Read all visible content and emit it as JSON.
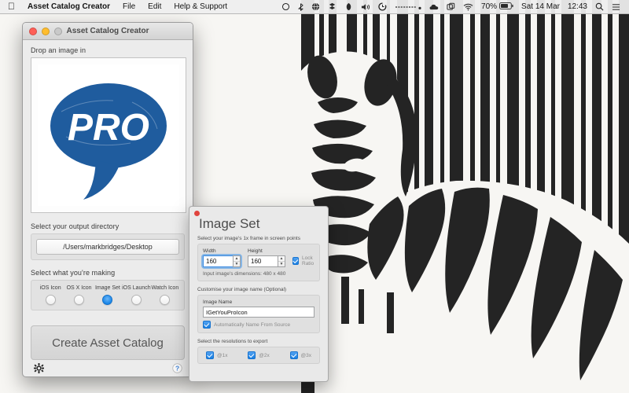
{
  "menubar": {
    "apple_icon": "apple-logo-icon",
    "app_name": "Asset Catalog Creator",
    "menus": [
      "File",
      "Edit",
      "Help & Support"
    ],
    "status_icons": [
      "airplay-icon",
      "bluetooth-icon",
      "globe-icon",
      "dropbox-icon",
      "cleanmymac-icon",
      "volume-icon",
      "timemachine-icon",
      "divider-icon",
      "cloud-icon",
      "screenflow-icon",
      "wifi-icon"
    ],
    "battery_percent": "70%",
    "battery_icon": "battery-icon",
    "date": "Sat 14 Mar",
    "time": "12:43",
    "search_icon": "spotlight-search-icon",
    "notification_icon": "notification-center-icon"
  },
  "app_window": {
    "title": "Asset Catalog Creator",
    "traffic_lights": [
      "close-button",
      "minimize-button",
      "zoom-button"
    ],
    "drop_label": "Drop an image in",
    "dropped_image": "pro-speech-bubble-logo",
    "output_dir_label": "Select your output directory",
    "output_dir_value": "/Users/markbridges/Desktop",
    "making_label": "Select what you're making",
    "making_options": [
      {
        "label": "iOS Icon",
        "selected": false
      },
      {
        "label": "OS X Icon",
        "selected": false
      },
      {
        "label": "Image Set",
        "selected": true
      },
      {
        "label": "iOS Launch",
        "selected": false
      },
      {
        "label": "Watch Icon",
        "selected": false
      }
    ],
    "create_button": "Create Asset Catalog",
    "settings_icon": "gear-icon",
    "help_icon": "help-question-icon"
  },
  "image_set_panel": {
    "title": "Image Set",
    "close_icon": "close-dot-icon",
    "frame_label": "Select your image's 1x frame in screen points",
    "width_label": "Width",
    "width_value": "160",
    "height_label": "Height",
    "height_value": "160",
    "lock_ratio_label": "Lock Ratio",
    "lock_ratio_checked": true,
    "dimensions_hint": "Input image's dimensions: 480 x 480",
    "customise_label": "Customise your image name (Optional)",
    "image_name_label": "Image Name",
    "image_name_value": "IGetYouProIcon",
    "auto_name_label": "Automatically Name From Source",
    "auto_name_checked": true,
    "resolutions_label": "Select the resolutions to export",
    "resolutions": [
      {
        "label": "@1x",
        "checked": true
      },
      {
        "label": "@2x",
        "checked": true
      },
      {
        "label": "@3x",
        "checked": true
      }
    ]
  },
  "desktop": {
    "wallpaper": "zebra-barcode-wallpaper"
  },
  "colors": {
    "accent_blue": "#1b87e8",
    "logo_blue": "#1f5c9e",
    "close_red": "#ff5f57",
    "min_yellow": "#ffbd2e"
  }
}
